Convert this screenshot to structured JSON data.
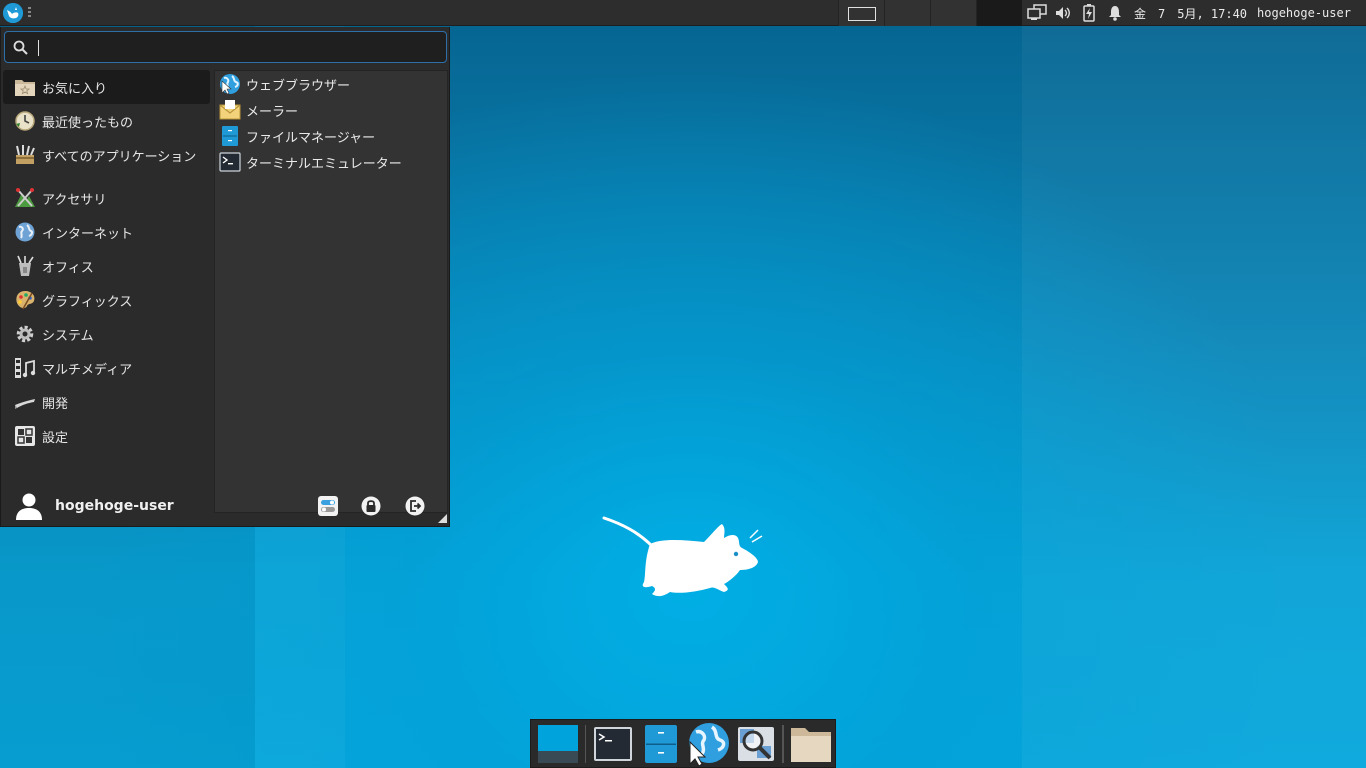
{
  "top_panel": {
    "clock": "金　7　5月, 17:40",
    "user": "hogehoge-user"
  },
  "menu": {
    "search": {
      "value": "",
      "placeholder": ""
    },
    "categories": [
      {
        "label": "お気に入り",
        "icon": "favorites-folder-icon",
        "active": true
      },
      {
        "label": "最近使ったもの",
        "icon": "recent-clock-icon"
      },
      {
        "label": "すべてのアプリケーション",
        "icon": "all-applications-icon"
      },
      {
        "label": "アクセサリ",
        "icon": "accessories-icon"
      },
      {
        "label": "インターネット",
        "icon": "internet-globe-icon"
      },
      {
        "label": "オフィス",
        "icon": "office-icon"
      },
      {
        "label": "グラフィックス",
        "icon": "graphics-palette-icon"
      },
      {
        "label": "システム",
        "icon": "system-gear-icon"
      },
      {
        "label": "マルチメディア",
        "icon": "multimedia-icon"
      },
      {
        "label": "開発",
        "icon": "development-icon"
      },
      {
        "label": "設定",
        "icon": "settings-icon"
      }
    ],
    "apps": [
      {
        "label": "ウェブブラウザー",
        "icon": "web-browser-icon"
      },
      {
        "label": "メーラー",
        "icon": "mail-icon"
      },
      {
        "label": "ファイルマネージャー",
        "icon": "file-manager-icon"
      },
      {
        "label": "ターミナルエミュレーター",
        "icon": "terminal-icon"
      }
    ],
    "footer": {
      "user_name": "hogehoge-user"
    }
  },
  "colors": {
    "panel_bg": "#2d2d2d",
    "menu_bg": "#2b2b2b",
    "accent": "#1f9ad6",
    "desktop": "#08a2d6"
  }
}
